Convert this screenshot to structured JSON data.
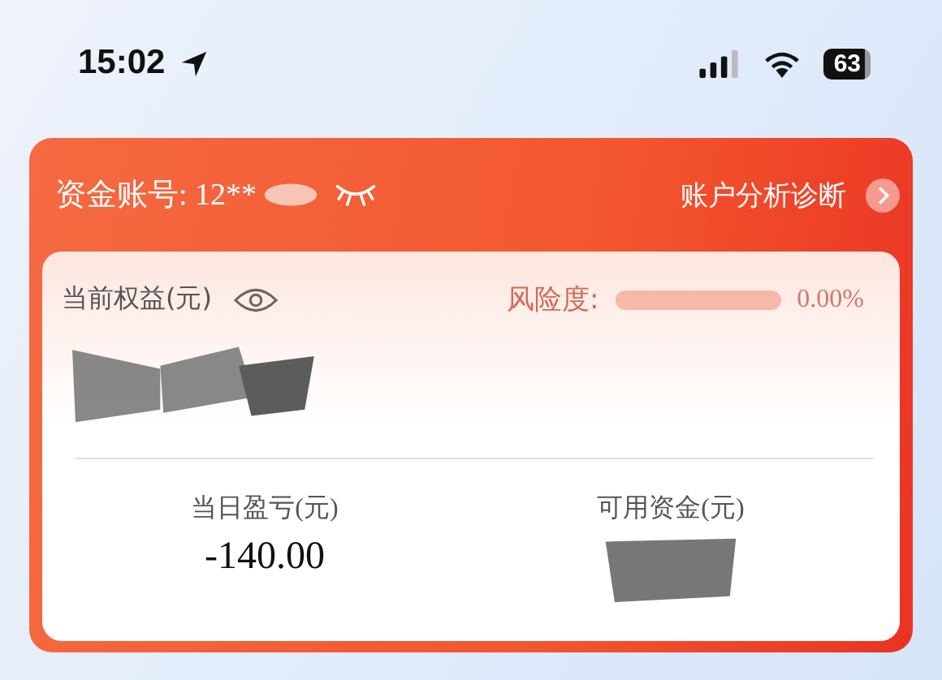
{
  "status_bar": {
    "time": "15:02",
    "battery": "63"
  },
  "account": {
    "label": "资金账号: 12**",
    "number_hidden": true,
    "diagnosis_link": "账户分析诊断"
  },
  "equity": {
    "label": "当前权益(元)",
    "value_visible": true
  },
  "risk": {
    "label": "风险度:",
    "level": 0,
    "reading": "0.00%"
  },
  "stats": [
    {
      "label": "当日盈亏(元)",
      "value": "-140.00",
      "redacted": false
    },
    {
      "label": "可用资金(元)",
      "redacted": true
    }
  ]
}
